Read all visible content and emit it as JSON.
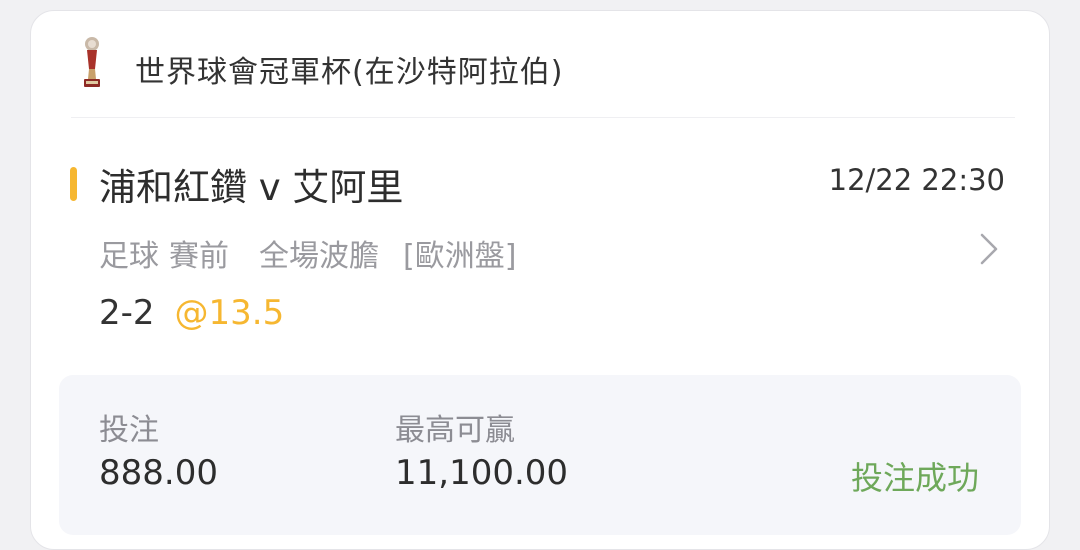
{
  "header": {
    "icon": "trophy-icon",
    "tournament": "世界球會冠軍杯(在沙特阿拉伯)"
  },
  "match": {
    "title": "浦和紅鑽 v 艾阿里",
    "time": "12/22 22:30",
    "sport": "足球",
    "phase": "賽前",
    "market": "全場波膽",
    "odds_format": "[歐洲盤]",
    "chevron_icon": "chevron-right-icon"
  },
  "selection": {
    "score": "2-2",
    "odds": "@13.5"
  },
  "summary": {
    "stake_label": "投注",
    "stake_value": "888.00",
    "max_win_label": "最高可贏",
    "max_win_value": "11,100.00",
    "status": "投注成功"
  },
  "colors": {
    "accent": "#f6b731",
    "success": "#6ea85a"
  }
}
